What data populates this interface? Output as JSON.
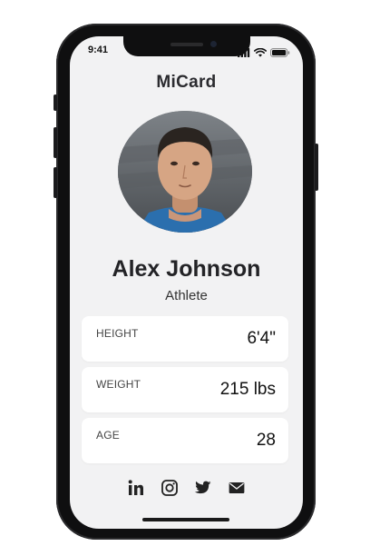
{
  "status_bar": {
    "time": "9:41",
    "icons": [
      "signal-icon",
      "wifi-icon",
      "battery-icon"
    ]
  },
  "app": {
    "title": "MiCard"
  },
  "profile": {
    "name": "Alex Johnson",
    "role": "Athlete"
  },
  "stats": [
    {
      "label": "HEIGHT",
      "value": "6'4\""
    },
    {
      "label": "WEIGHT",
      "value": "215 lbs"
    },
    {
      "label": "AGE",
      "value": "28"
    }
  ],
  "social_links": [
    "linkedin-icon",
    "instagram-icon",
    "twitter-icon",
    "email-icon"
  ],
  "colors": {
    "screen_bg": "#f2f2f3",
    "card_bg": "#ffffff",
    "text_primary": "#232326",
    "device_frame": "#0f0f10"
  }
}
